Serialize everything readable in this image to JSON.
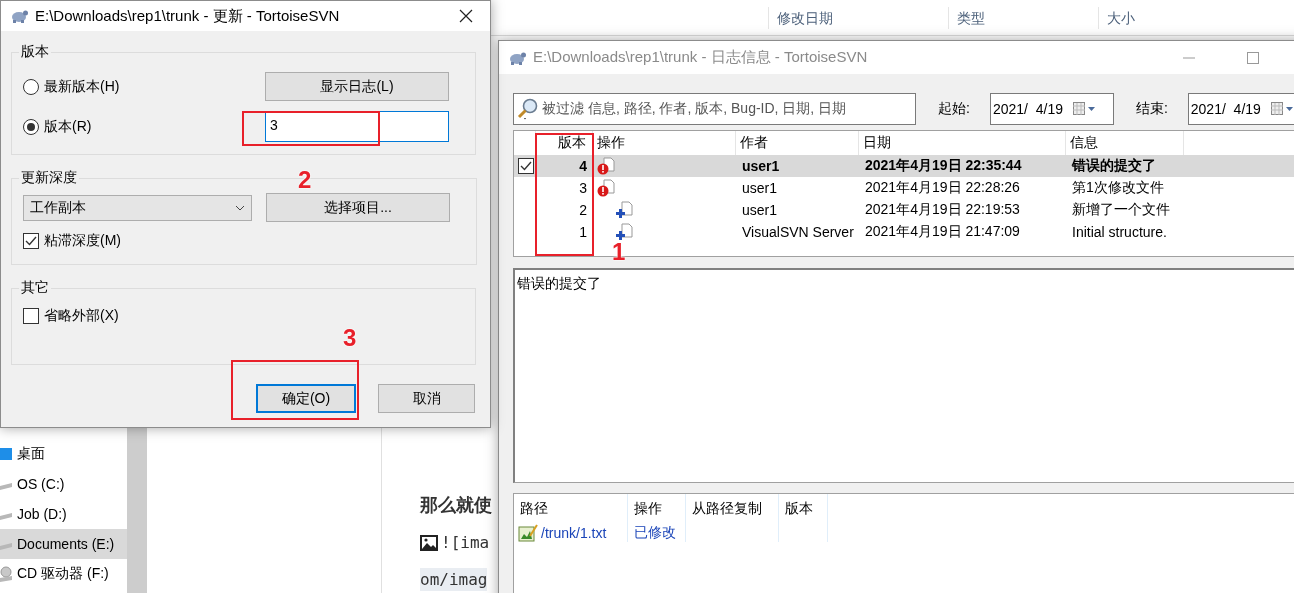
{
  "explorer": {
    "columns": [
      "修改日期",
      "类型",
      "大小"
    ],
    "nav_items": [
      {
        "label": "桌面",
        "kind": "desktop",
        "selected": false
      },
      {
        "label": "OS (C:)",
        "kind": "drive",
        "selected": false
      },
      {
        "label": "Job (D:)",
        "kind": "drive",
        "selected": false
      },
      {
        "label": "Documents (E:)",
        "kind": "drive",
        "selected": true
      },
      {
        "label": "CD 驱动器 (F:)",
        "kind": "cd",
        "selected": false
      }
    ],
    "editor": {
      "heading": "那么就使",
      "lines": [
        {
          "kind": "image-link",
          "text": "![ima"
        },
        {
          "kind": "code",
          "text": "om/imag"
        }
      ]
    }
  },
  "update_dialog": {
    "title": "E:\\Downloads\\rep1\\trunk - 更新 - TortoiseSVN",
    "revision_group": {
      "title": "版本",
      "options": [
        {
          "label": "最新版本(H)",
          "selected": false
        },
        {
          "label": "版本(R)",
          "selected": true
        }
      ],
      "show_log_button": "显示日志(L)",
      "revision_input": {
        "value": "3",
        "focused": true
      }
    },
    "depth_group": {
      "title": "更新深度",
      "depth_select": "工作副本",
      "choose_items_button": "选择项目...",
      "sticky_depth": {
        "label": "粘滞深度(M)",
        "checked": true
      }
    },
    "other_group": {
      "title": "其它",
      "omit_externals": {
        "label": "省略外部(X)",
        "checked": false
      }
    },
    "buttons": [
      {
        "label": "确定(O)",
        "default": true
      },
      {
        "label": "取消",
        "default": false
      }
    ]
  },
  "log_dialog": {
    "title": "E:\\Downloads\\rep1\\trunk - 日志信息 - TortoiseSVN",
    "filter": {
      "placeholder": "被过滤 信息, 路径, 作者, 版本, Bug-ID, 日期, 日期"
    },
    "from": {
      "label": "起始:",
      "value": "2021/  4/19"
    },
    "to": {
      "label": "结束:",
      "value": "2021/  4/19"
    },
    "revisions": {
      "columns": [
        "版本",
        "操作",
        "作者",
        "日期",
        "信息"
      ],
      "rows": [
        {
          "revision": "4",
          "checked": true,
          "selected": true,
          "kind": "modified",
          "author": "user1",
          "date": "2021年4月19日 22:35:44",
          "message": "错误的提交了"
        },
        {
          "revision": "3",
          "checked": false,
          "selected": false,
          "kind": "modified",
          "author": "user1",
          "date": "2021年4月19日 22:28:26",
          "message": "第1次修改文件"
        },
        {
          "revision": "2",
          "checked": false,
          "selected": false,
          "kind": "added",
          "author": "user1",
          "date": "2021年4月19日 22:19:53",
          "message": "新增了一个文件"
        },
        {
          "revision": "1",
          "checked": false,
          "selected": false,
          "kind": "added",
          "author": "VisualSVN Server",
          "date": "2021年4月19日 21:47:09",
          "message": "Initial structure."
        }
      ]
    },
    "message": "错误的提交了",
    "changed_paths": {
      "columns": [
        "路径",
        "操作",
        "从路径复制",
        "版本"
      ],
      "rows": [
        {
          "path": "/trunk/1.txt",
          "action": "已修改"
        }
      ]
    }
  },
  "annotations": [
    {
      "number": "1"
    },
    {
      "number": "2"
    },
    {
      "number": "3"
    }
  ]
}
